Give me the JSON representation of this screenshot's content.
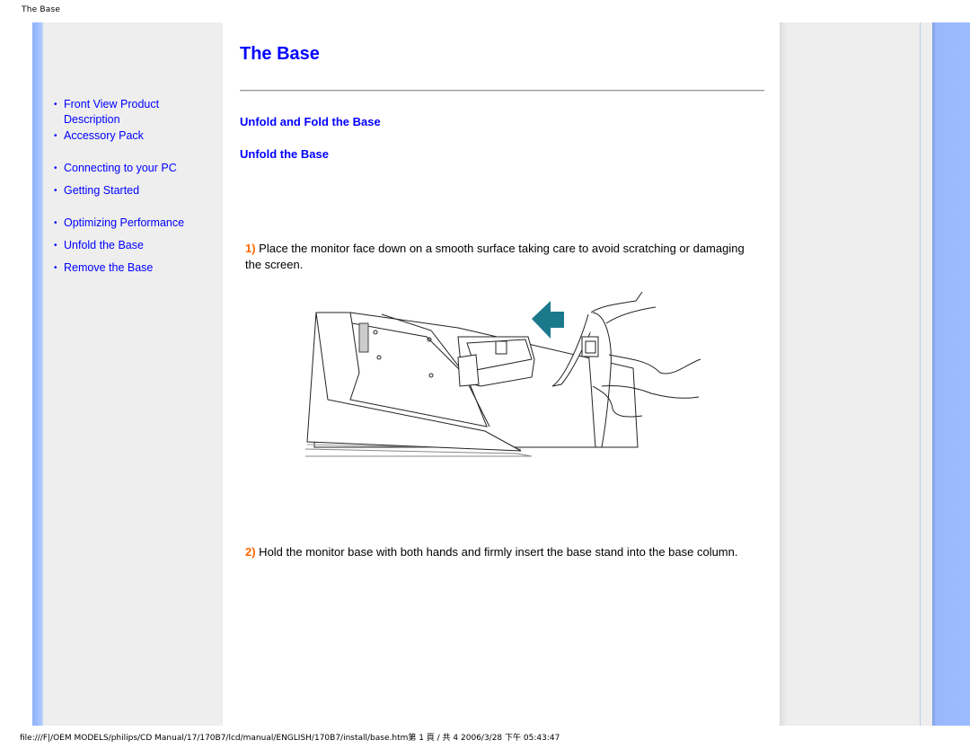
{
  "window": {
    "title": "The Base"
  },
  "nav": {
    "items": [
      {
        "label_line1": "Front View Product",
        "label_line2": "Description"
      },
      {
        "label_line1": "Accessory Pack"
      },
      {
        "label_line1": "Connecting to your PC"
      },
      {
        "label_line1": "Getting Started"
      },
      {
        "label_line1": "Optimizing Performance"
      },
      {
        "label_line1": "Unfold the Base"
      },
      {
        "label_line1": "Remove the Base"
      }
    ],
    "bullet": "•"
  },
  "main": {
    "title": "The Base",
    "section_heading": "Unfold and Fold the Base",
    "subsection_heading": "Unfold the Base",
    "steps": [
      {
        "num": "1)",
        "text": " Place the monitor face down on a smooth surface taking care to avoid scratching or damaging the screen."
      },
      {
        "num": "2)",
        "text": " Hold the monitor base with both hands and firmly insert the base stand into the base column."
      }
    ],
    "figure": {
      "description": "monitor-face-down-with-base-stand-insertion",
      "arrow_color": "#1a7a8c"
    }
  },
  "footer": {
    "path": "file:///F|/OEM MODELS/philips/CD Manual/17/170B7/lcd/manual/ENGLISH/170B7/install/base.htm第 1 頁 / 共 4 2006/3/28 下午 05:43:47"
  },
  "colors": {
    "link": "#0000ff",
    "step_number": "#ff6600",
    "stripe": "#9bbcff",
    "panel": "#eeeeee"
  }
}
